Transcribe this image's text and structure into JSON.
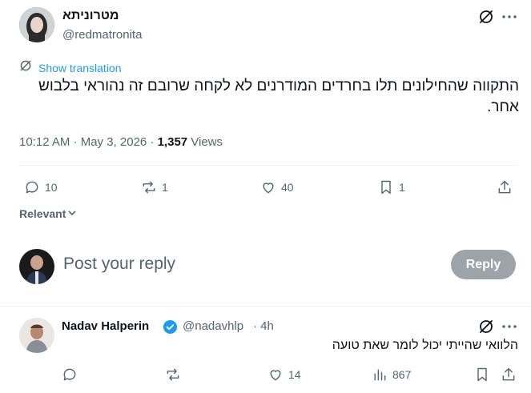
{
  "tweet": {
    "author_name": "מטרוניתא",
    "author_handle": "@redmatronita",
    "show_translation": "Show translation",
    "text": "התקווה שהחילונים תלו בחרדים המודרנים לא לקחה שרובם זה נהוראי בלבוש אחר.",
    "timestamp": "10:12 AM · May 3, 2026 · ",
    "views_count": "1,357",
    "views_label": " Views",
    "replies": "10",
    "reposts": "1",
    "likes": "40",
    "bookmarks": "1"
  },
  "sort": {
    "label": "Relevant"
  },
  "composer": {
    "placeholder": "Post your reply",
    "reply_label": "Reply"
  },
  "reply": {
    "author_name": "Nadav Halperin",
    "author_handle": "@nadavhlp",
    "time": "· 4h",
    "text": "הלוואי שהייתי יכול לומר שאת טועה",
    "likes": "14",
    "views": "867"
  },
  "colors": {
    "accent": "#1d9bf0",
    "verified": "#1d9bf0",
    "text": "#0f1419",
    "muted": "#536471"
  }
}
